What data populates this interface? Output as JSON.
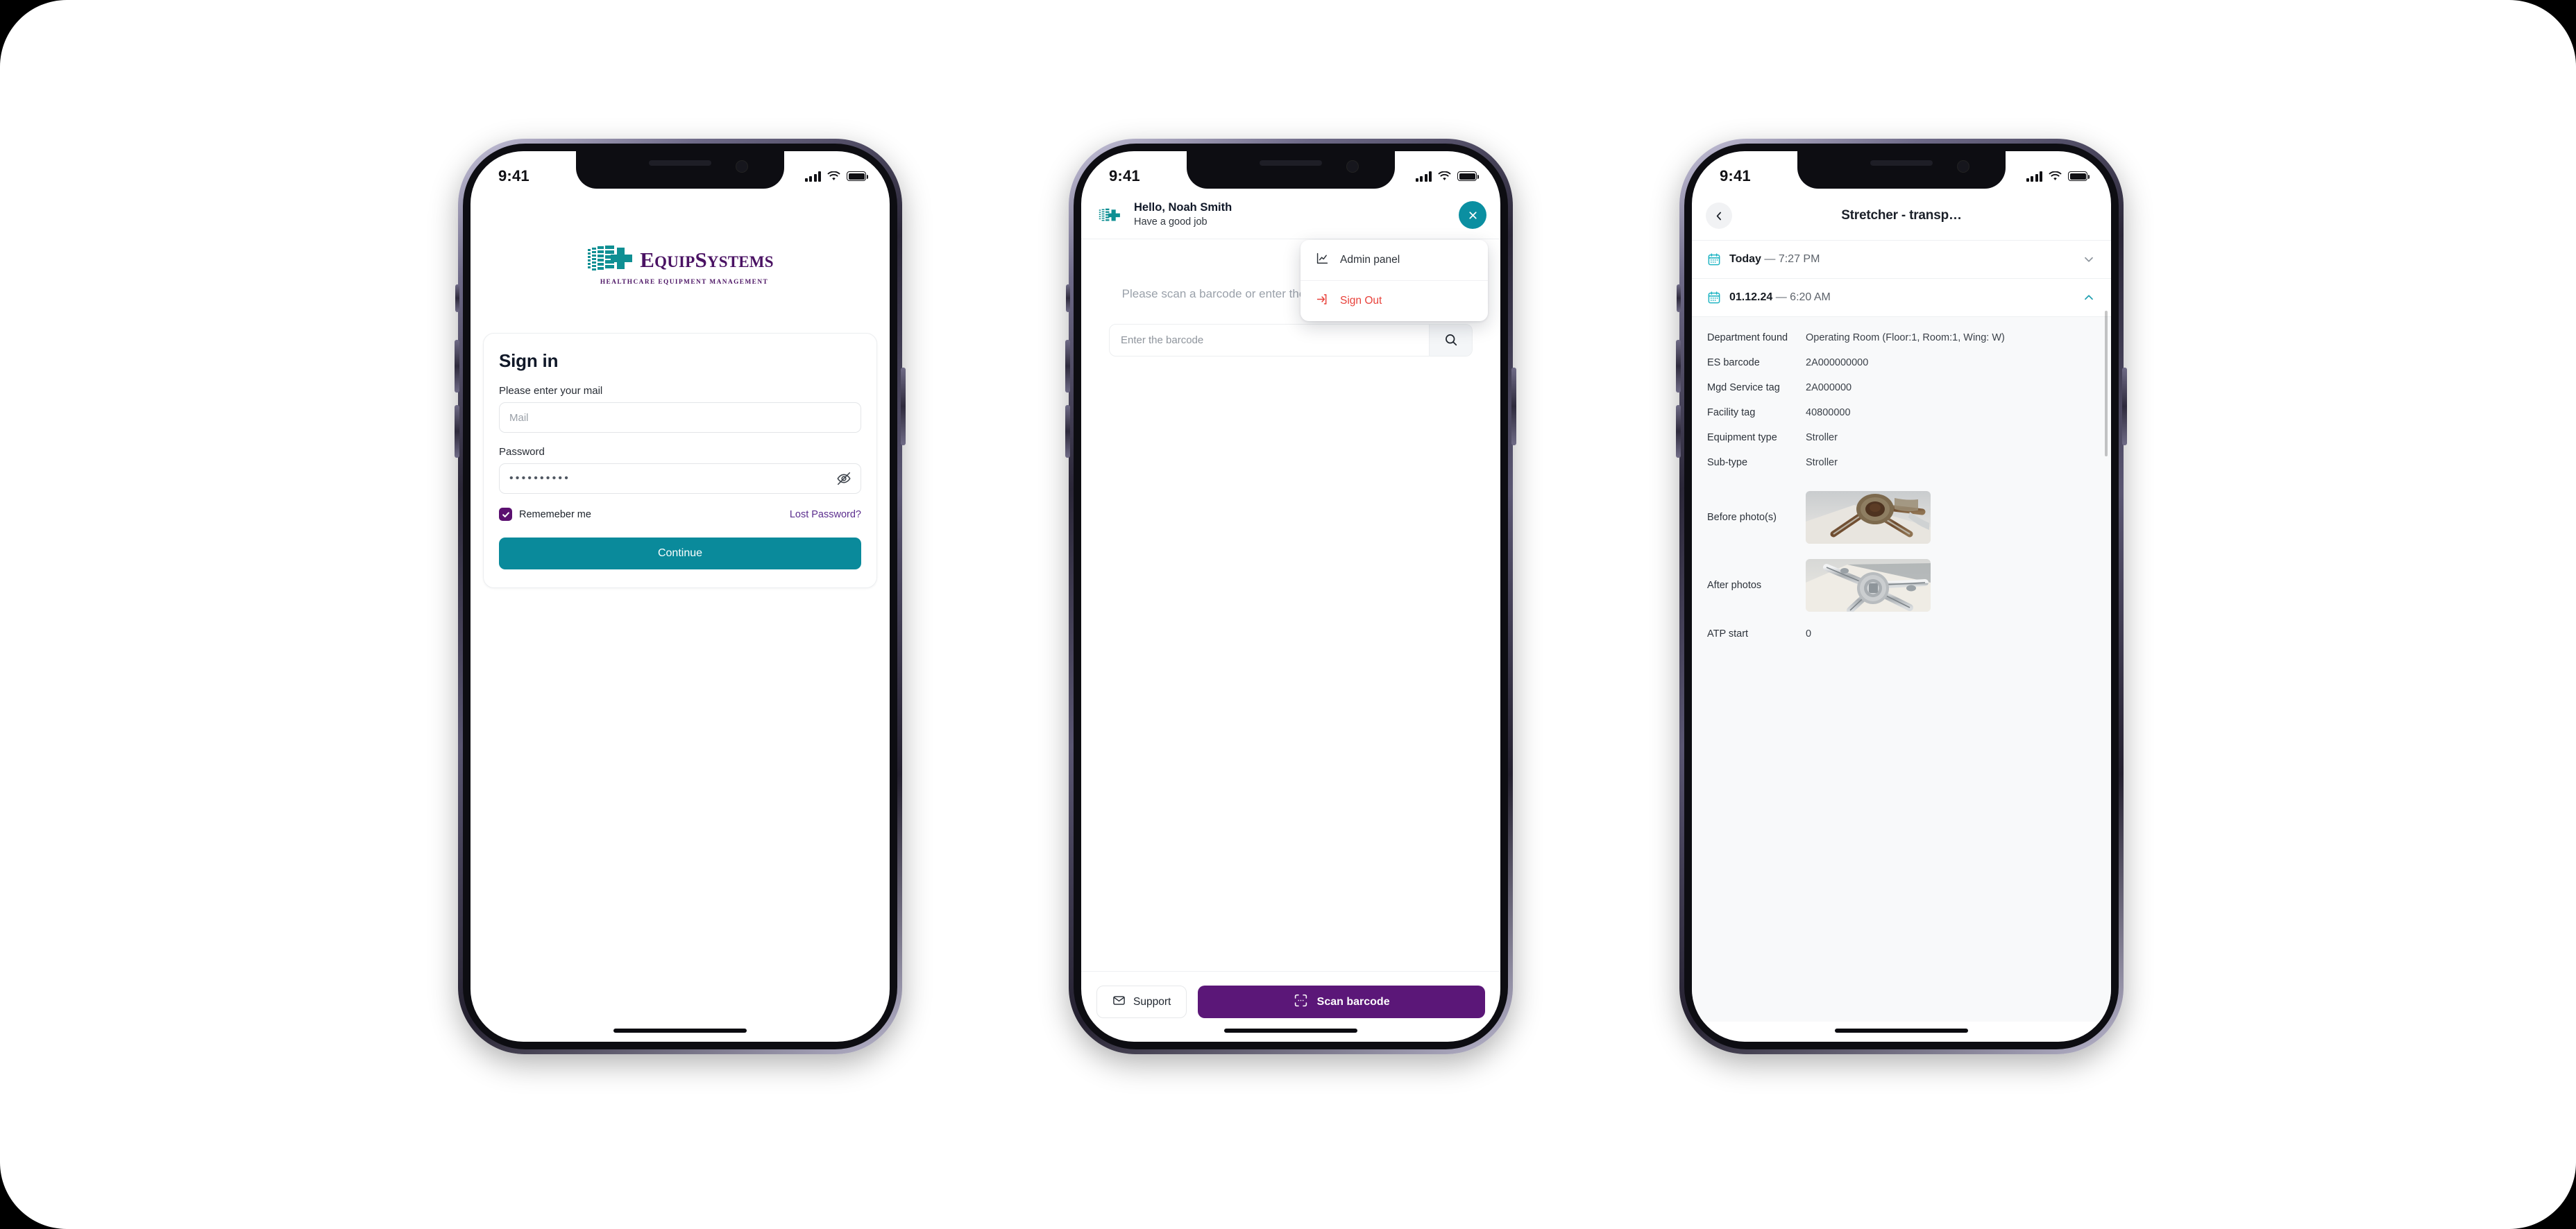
{
  "phones": [
    {
      "id": "signin",
      "status_bar": {
        "time": "9:41",
        "signal_icon": "cellular-signal-icon",
        "wifi_icon": "wifi-icon",
        "battery_icon": "battery-icon"
      },
      "logo": {
        "name_part1": "E",
        "name_part2": "QUIP",
        "name_part3": "S",
        "name_part4": "YSTEMS",
        "tagline": "HEALTHCARE EQUIPMENT MANAGEMENT"
      },
      "signin": {
        "title": "Sign in",
        "email_label": "Please enter your mail",
        "email_value": "",
        "email_placeholder": "Mail",
        "password_label": "Password",
        "password_masked": "••••••••••",
        "toggle_password_icon": "eye-off-icon",
        "remember_label": "Rememeber me",
        "remember_checked": true,
        "lost_password_label": "Lost Password?",
        "continue_label": "Continue"
      }
    },
    {
      "id": "home",
      "status_bar": {
        "time": "9:41"
      },
      "header": {
        "avatar_icon": "equipsystems-avatar-icon",
        "greeting": "Hello, Noah Smith",
        "subtitle": "Have a good job",
        "close_icon": "close-icon"
      },
      "menu": {
        "items": [
          {
            "label": "Admin panel",
            "icon": "chart-line-icon",
            "danger": false
          },
          {
            "label": "Sign Out",
            "icon": "sign-out-icon",
            "danger": true
          }
        ]
      },
      "scan_hint": "Please scan a barcode or enter the number to search for an item",
      "search": {
        "value": "",
        "placeholder": "Enter the barcode",
        "search_icon": "search-icon"
      },
      "footer": {
        "support_label": "Support",
        "support_icon": "mail-icon",
        "scan_label": "Scan barcode",
        "scan_icon": "scan-barcode-icon"
      }
    },
    {
      "id": "detail",
      "status_bar": {
        "time": "9:41"
      },
      "header": {
        "back_icon": "chevron-left-icon",
        "title": "Stretcher - transp…"
      },
      "accordions": [
        {
          "icon": "calendar-icon",
          "date": "Today",
          "dash": " — ",
          "time": "7:27 PM",
          "expanded": false,
          "chevron": "chevron-down-icon"
        },
        {
          "icon": "calendar-icon",
          "date": "01.12.24",
          "dash": " — ",
          "time": "6:20 AM",
          "expanded": true,
          "chevron": "chevron-up-icon"
        }
      ],
      "details": [
        {
          "key": "Department found",
          "value": "Operating Room (Floor:1, Room:1, Wing: W)"
        },
        {
          "key": "ES barcode",
          "value": "2A000000000"
        },
        {
          "key": "Mgd Service tag",
          "value": "2A000000"
        },
        {
          "key": "Facility tag",
          "value": "40800000"
        },
        {
          "key": "Equipment type",
          "value": "Stroller"
        },
        {
          "key": "Sub-type",
          "value": "Stroller"
        }
      ],
      "photos": [
        {
          "key": "Before photo(s)",
          "name": "before-photo-thumbnail"
        },
        {
          "key": "After photos",
          "name": "after-photo-thumbnail"
        }
      ],
      "atp": {
        "key": "ATP start",
        "value": "0"
      }
    }
  ],
  "colors": {
    "teal": "#0a8a9b",
    "teal_fab": "#0b8fa1",
    "purple": "#5b1778",
    "purple_logo": "#4a1263",
    "danger": "#e8413a",
    "link": "#5b2d8e"
  }
}
